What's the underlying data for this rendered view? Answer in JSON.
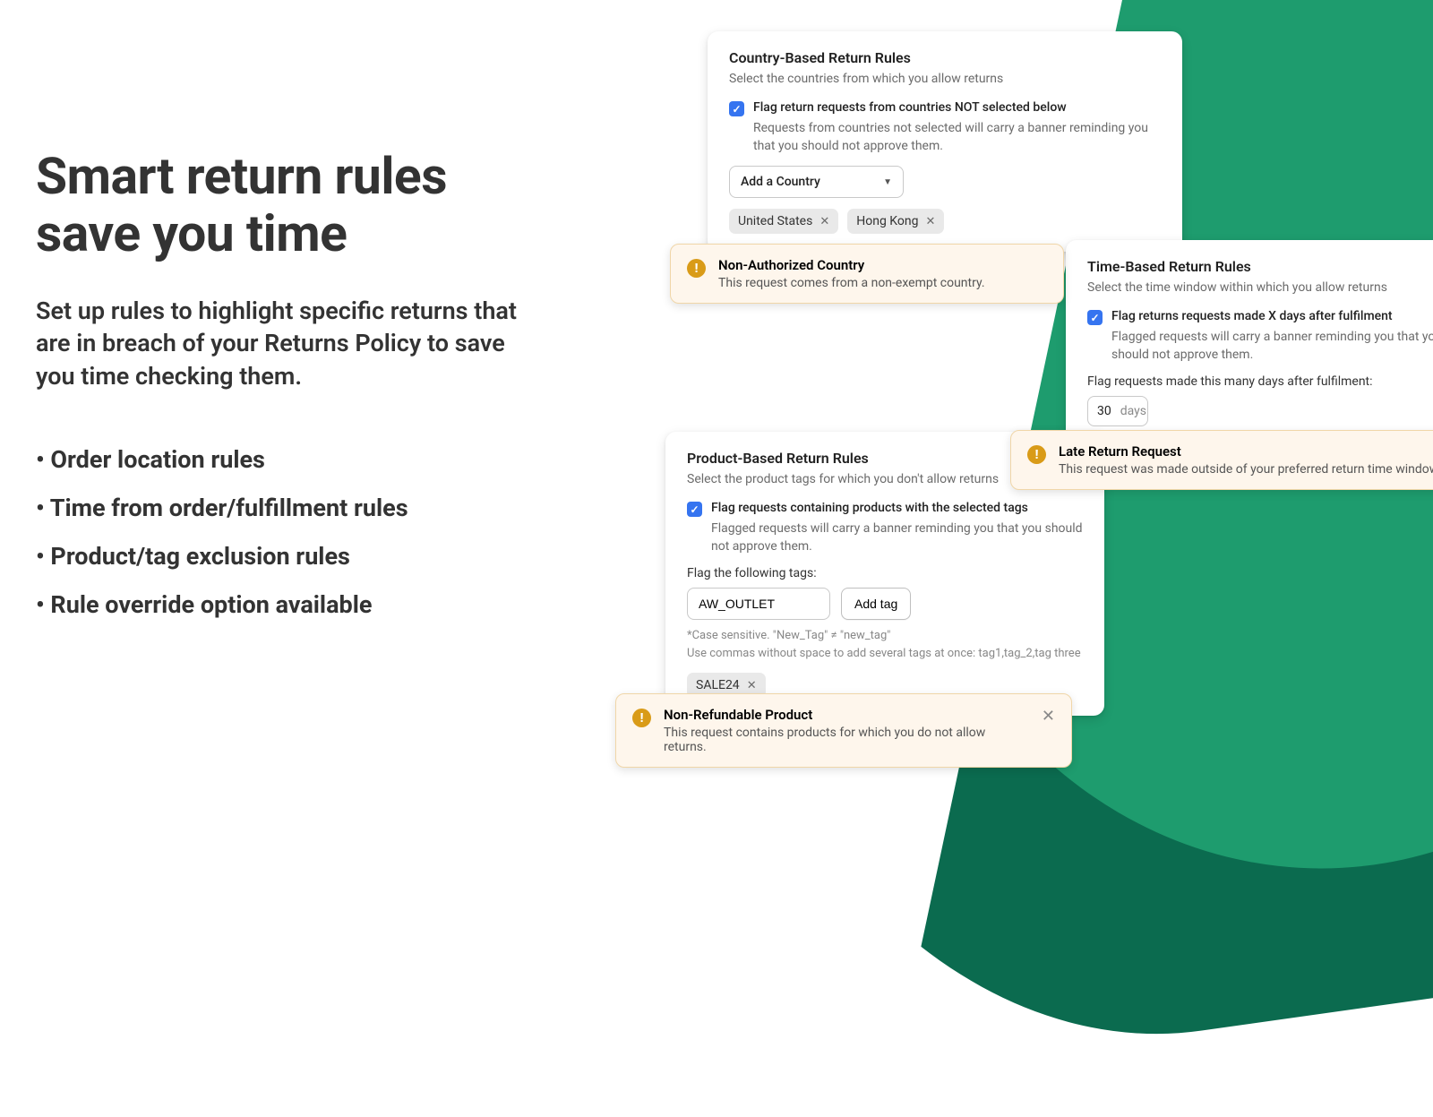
{
  "left": {
    "headline": "Smart return rules save you time",
    "subhead": "Set up rules to highlight specific returns that are in breach of your Returns Policy to save you time checking them.",
    "bullets": [
      "Order location rules",
      "Time from order/fulfillment rules",
      "Product/tag exclusion rules",
      "Rule override option available"
    ]
  },
  "country_card": {
    "title": "Country-Based Return Rules",
    "sub": "Select the countries from which you allow returns",
    "check_label": "Flag return requests from countries NOT selected below",
    "check_desc": "Requests from countries not selected will carry a banner reminding you that you should not approve them.",
    "select_label": "Add a Country",
    "tags": [
      "United States",
      "Hong Kong"
    ]
  },
  "country_banner": {
    "title": "Non-Authorized Country",
    "text": "This request comes from a non-exempt country."
  },
  "time_card": {
    "title": "Time-Based Return Rules",
    "sub": "Select the time window within which you allow returns",
    "check_label": "Flag returns requests made X days after fulfilment",
    "check_desc": "Flagged requests will carry a banner reminding you that you should not approve them.",
    "field_label": "Flag requests made this many days after fulfilment:",
    "days_value": "30",
    "days_unit": "days"
  },
  "time_banner": {
    "title": "Late Return Request",
    "text": "This request was made outside of your preferred return time window."
  },
  "product_card": {
    "title": "Product-Based Return Rules",
    "sub": "Select the product tags for which you don't allow returns",
    "check_label": "Flag requests containing products with the selected tags",
    "check_desc": "Flagged requests will carry a banner reminding you that you should not approve them.",
    "field_label": "Flag the following tags:",
    "input_value": "AW_OUTLET",
    "add_btn": "Add tag",
    "note1": "*Case sensitive. \"New_Tag\" ≠ \"new_tag\"",
    "note2": "Use commas without space to add several tags at once: tag1,tag_2,tag three",
    "tags": [
      "SALE24"
    ]
  },
  "product_banner": {
    "title": "Non-Refundable Product",
    "text": "This request contains products for which you do not allow returns."
  }
}
